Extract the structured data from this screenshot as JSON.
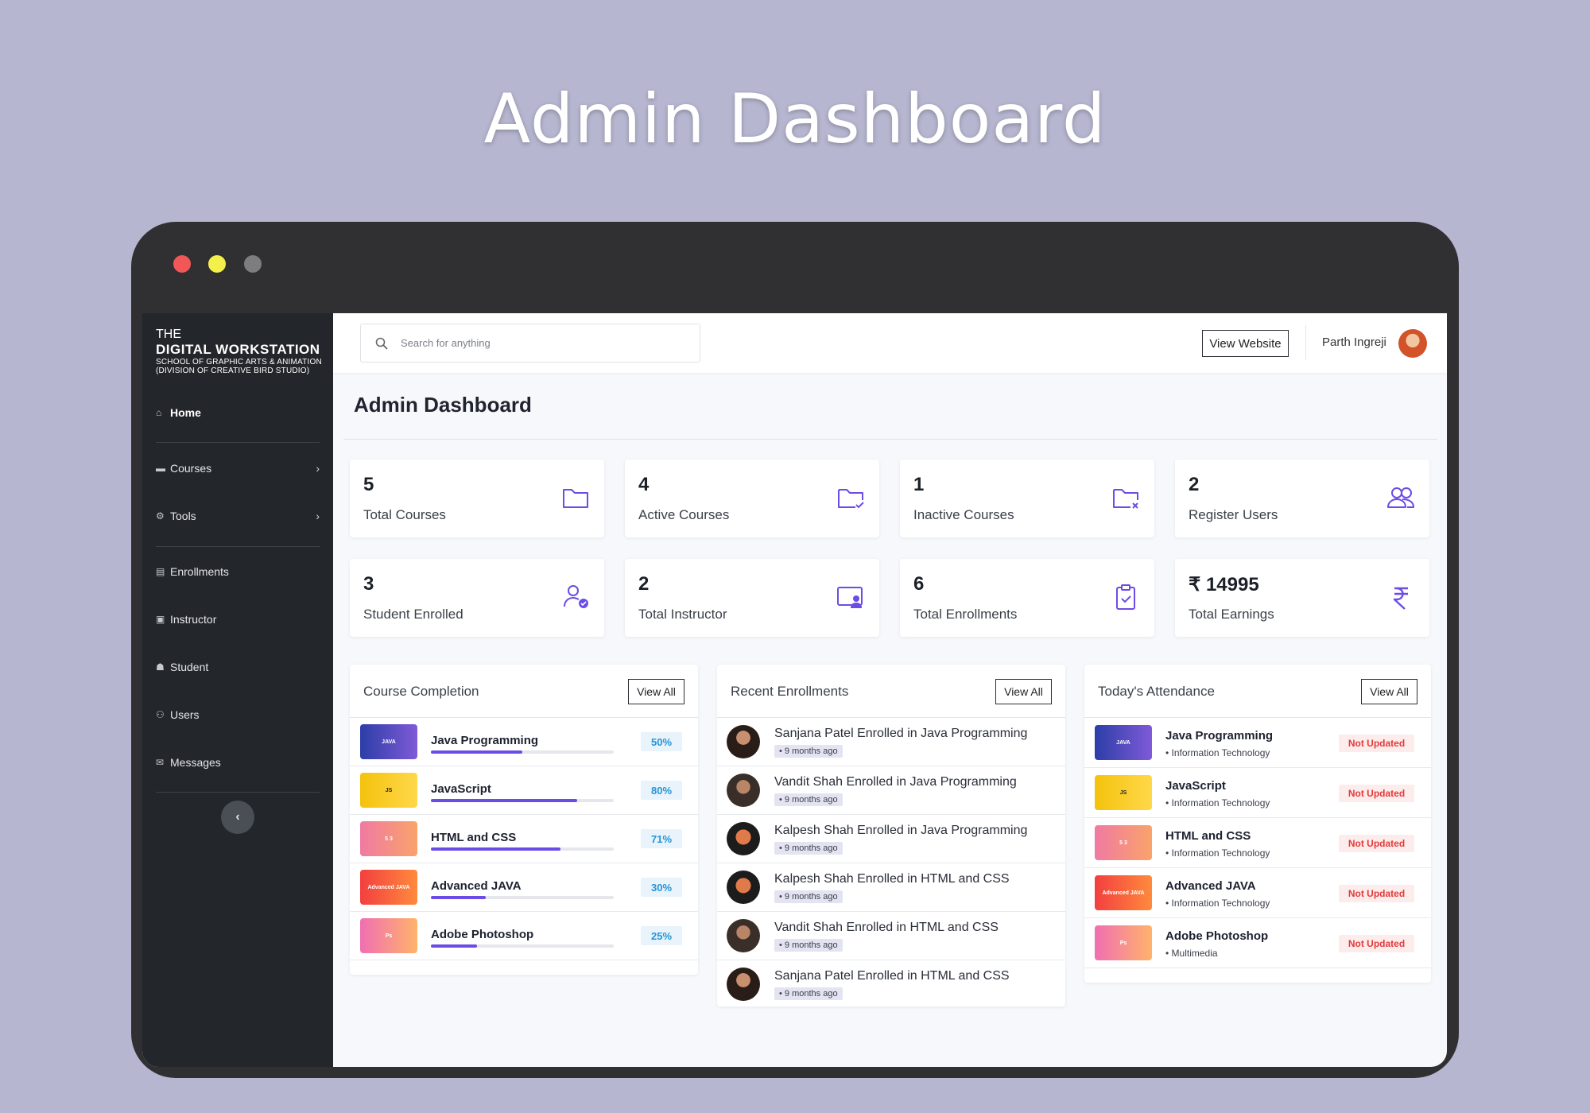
{
  "hero": {
    "title": "Admin Dashboard"
  },
  "sidebar": {
    "logo": {
      "line1": "THE",
      "line2": "DIGITAL WORKSTATION",
      "line3": "SCHOOL OF GRAPHIC ARTS & ANIMATION",
      "line4": "(DIVISION OF CREATIVE BIRD STUDIO)"
    },
    "items": [
      {
        "label": "Home",
        "icon": "home-icon"
      },
      {
        "label": "Courses",
        "icon": "folder-icon"
      },
      {
        "label": "Tools",
        "icon": "gear-icon"
      },
      {
        "label": "Enrollments",
        "icon": "clipboard-icon"
      },
      {
        "label": "Instructor",
        "icon": "instructor-icon"
      },
      {
        "label": "Student",
        "icon": "student-icon"
      },
      {
        "label": "Users",
        "icon": "users-icon"
      },
      {
        "label": "Messages",
        "icon": "mail-icon"
      }
    ],
    "collapse_icon": "chevron-left-icon"
  },
  "topbar": {
    "search_placeholder": "Search for anything",
    "view_website": "View Website",
    "user_name": "Parth Ingreji"
  },
  "page": {
    "title": "Admin Dashboard"
  },
  "stats": [
    {
      "value": "5",
      "label": "Total Courses",
      "icon": "folder-icon"
    },
    {
      "value": "4",
      "label": "Active Courses",
      "icon": "folder-check-icon"
    },
    {
      "value": "1",
      "label": "Inactive Courses",
      "icon": "folder-x-icon"
    },
    {
      "value": "2",
      "label": "Register Users",
      "icon": "users-icon"
    },
    {
      "value": "3",
      "label": "Student Enrolled",
      "icon": "user-check-icon"
    },
    {
      "value": "2",
      "label": "Total Instructor",
      "icon": "instructor-icon"
    },
    {
      "value": "6",
      "label": "Total Enrollments",
      "icon": "clipboard-check-icon"
    },
    {
      "value": "₹ 14995",
      "label": "Total Earnings",
      "icon": "rupee-icon"
    }
  ],
  "course_completion": {
    "title": "Course Completion",
    "view_all": "View All",
    "rows": [
      {
        "name": "Java Programming",
        "percent_text": "50%",
        "progress": 0.5,
        "thumb_label": "JAVA"
      },
      {
        "name": "JavaScript",
        "percent_text": "80%",
        "progress": 0.8,
        "thumb_label": "JS"
      },
      {
        "name": "HTML and CSS",
        "percent_text": "71%",
        "progress": 0.71,
        "thumb_label": "5 3"
      },
      {
        "name": "Advanced JAVA",
        "percent_text": "30%",
        "progress": 0.3,
        "thumb_label": "Advanced JAVA"
      },
      {
        "name": "Adobe Photoshop",
        "percent_text": "25%",
        "progress": 0.25,
        "thumb_label": "Ps"
      }
    ]
  },
  "recent_enrollments": {
    "title": "Recent Enrollments",
    "view_all": "View All",
    "rows": [
      {
        "text": "Sanjana Patel Enrolled in Java Programming",
        "time": "• 9 months ago"
      },
      {
        "text": "Vandit Shah Enrolled in Java Programming",
        "time": "• 9 months ago"
      },
      {
        "text": "Kalpesh Shah Enrolled in Java Programming",
        "time": "• 9 months ago"
      },
      {
        "text": "Kalpesh Shah Enrolled in HTML and CSS",
        "time": "• 9 months ago"
      },
      {
        "text": "Vandit Shah Enrolled in HTML and CSS",
        "time": "• 9 months ago"
      },
      {
        "text": "Sanjana Patel Enrolled in HTML and CSS",
        "time": "• 9 months ago"
      }
    ]
  },
  "attendance": {
    "title": "Today's Attendance",
    "view_all": "View All",
    "rows": [
      {
        "name": "Java Programming",
        "dept": "• Information Technology",
        "status": "Not Updated",
        "thumb_label": "JAVA"
      },
      {
        "name": "JavaScript",
        "dept": "• Information Technology",
        "status": "Not Updated",
        "thumb_label": "JS"
      },
      {
        "name": "HTML and CSS",
        "dept": "• Information Technology",
        "status": "Not Updated",
        "thumb_label": "5 3"
      },
      {
        "name": "Advanced JAVA",
        "dept": "• Information Technology",
        "status": "Not Updated",
        "thumb_label": "Advanced JAVA"
      },
      {
        "name": "Adobe Photoshop",
        "dept": "• Multimedia",
        "status": "Not Updated",
        "thumb_label": "Ps"
      }
    ]
  },
  "colors": {
    "accent": "#6c4ce6",
    "sidebar_bg": "#23262b",
    "percent_text": "#2694d6",
    "status_red": "#e23b3b"
  }
}
